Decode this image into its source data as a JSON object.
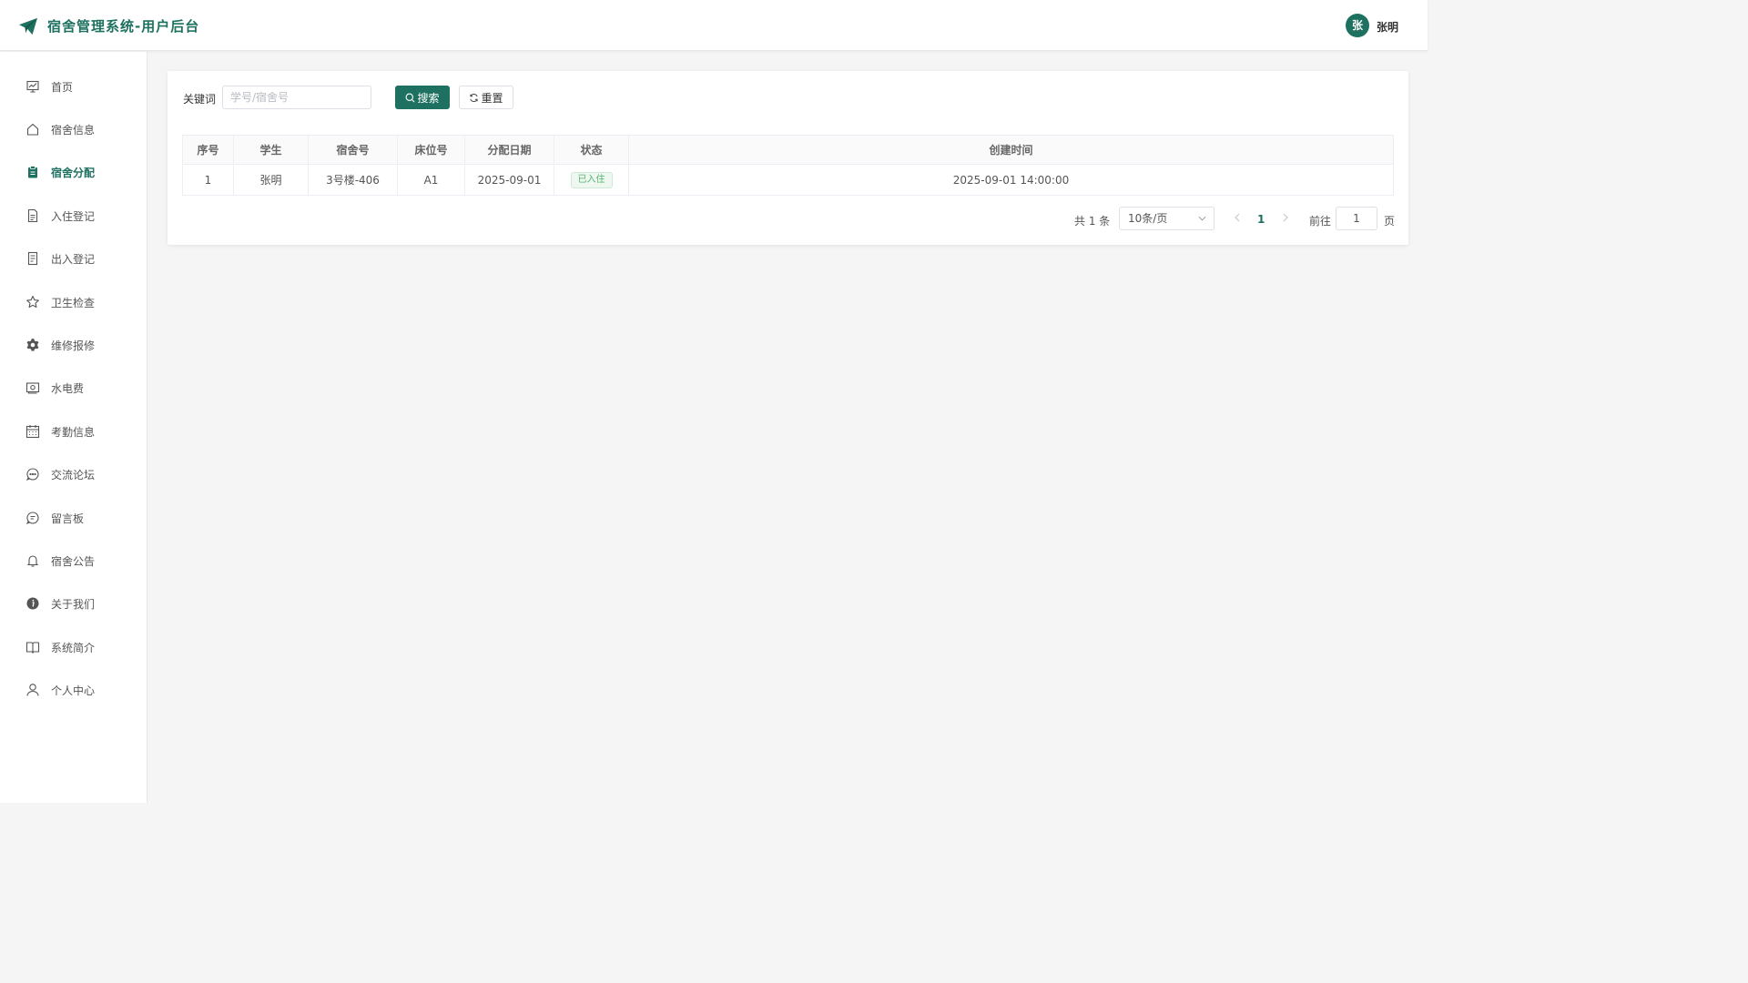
{
  "header": {
    "title": "宿舍管理系统-用户后台",
    "logo_icon": "paper-plane-icon",
    "user": {
      "avatar_text": "张",
      "name": "张明"
    }
  },
  "sidebar": {
    "items": [
      {
        "label": "首页",
        "icon": "chart-board-icon",
        "active": false
      },
      {
        "label": "宿舍信息",
        "icon": "home-icon",
        "active": false
      },
      {
        "label": "宿舍分配",
        "icon": "clipboard-icon",
        "active": true
      },
      {
        "label": "入住登记",
        "icon": "document-icon",
        "active": false
      },
      {
        "label": "出入登记",
        "icon": "document-list-icon",
        "active": false
      },
      {
        "label": "卫生检查",
        "icon": "star-icon",
        "active": false
      },
      {
        "label": "维修报修",
        "icon": "gear-icon",
        "active": false
      },
      {
        "label": "水电费",
        "icon": "money-icon",
        "active": false
      },
      {
        "label": "考勤信息",
        "icon": "calendar-icon",
        "active": false
      },
      {
        "label": "交流论坛",
        "icon": "chat-dots-icon",
        "active": false
      },
      {
        "label": "留言板",
        "icon": "message-icon",
        "active": false
      },
      {
        "label": "宿舍公告",
        "icon": "bell-icon",
        "active": false
      },
      {
        "label": "关于我们",
        "icon": "info-icon",
        "active": false
      },
      {
        "label": "系统简介",
        "icon": "book-icon",
        "active": false
      },
      {
        "label": "个人中心",
        "icon": "user-icon",
        "active": false
      }
    ]
  },
  "search": {
    "label": "关键词",
    "placeholder": "学号/宿舍号",
    "value": "",
    "search_button": "搜索",
    "reset_button": "重置"
  },
  "table": {
    "columns": [
      "序号",
      "学生",
      "宿舍号",
      "床位号",
      "分配日期",
      "状态",
      "创建时间"
    ],
    "rows": [
      {
        "index": "1",
        "student": "张明",
        "dorm": "3号楼-406",
        "bed": "A1",
        "date": "2025-09-01",
        "status": "已入住",
        "created": "2025-09-01 14:00:00"
      }
    ]
  },
  "pagination": {
    "total_text": "共 1 条",
    "page_size": "10条/页",
    "current_page": "1",
    "goto_label": "前往",
    "goto_value": "1",
    "page_unit": "页"
  },
  "colors": {
    "primary": "#1e7160",
    "status_green": "#52b46c",
    "background": "#f4f5f4"
  }
}
